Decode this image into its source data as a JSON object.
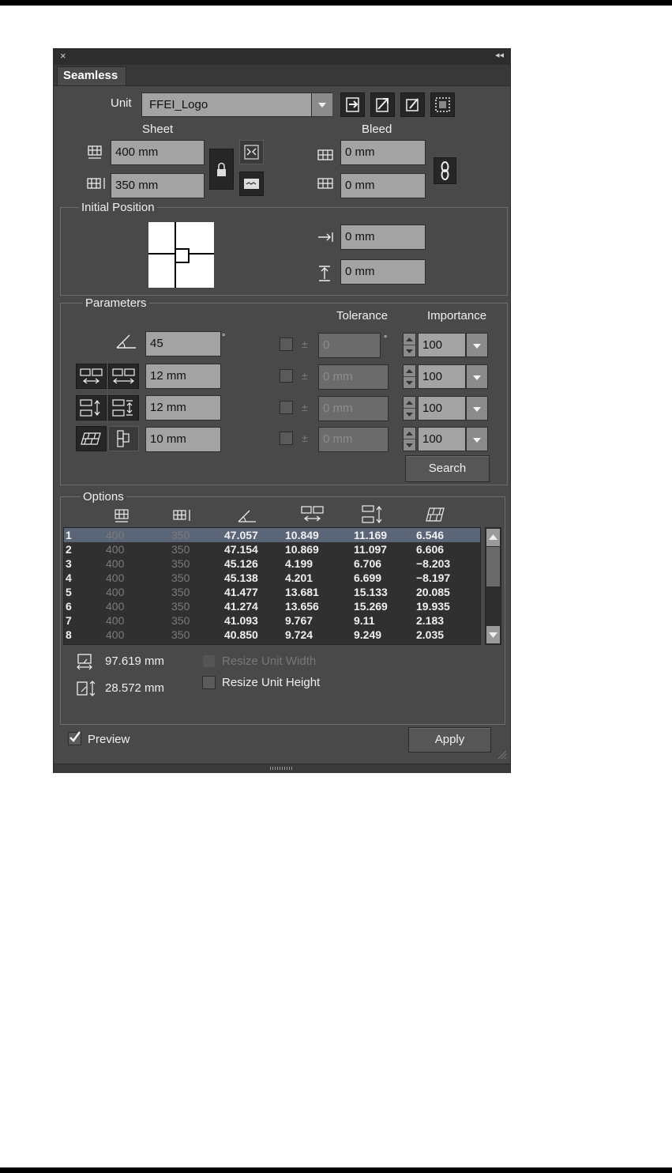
{
  "panel": {
    "tab": "Seamless",
    "close_glyph": "×",
    "collapse_glyph": "◂◂"
  },
  "unit": {
    "label": "Unit",
    "value": "FFEI_Logo"
  },
  "sheet": {
    "label": "Sheet",
    "width": "400 mm",
    "height": "350 mm"
  },
  "bleed": {
    "label": "Bleed",
    "horizontal": "0 mm",
    "vertical": "0 mm"
  },
  "initial_position": {
    "label": "Initial Position",
    "x_offset": "0 mm",
    "y_offset": "0 mm"
  },
  "parameters": {
    "label": "Parameters",
    "tolerance_header": "Tolerance",
    "importance_header": "Importance",
    "degree_symbol": "°",
    "plus_minus": "±",
    "rows": [
      {
        "value": "45",
        "tolerance": "0",
        "importance": "100"
      },
      {
        "value": "12 mm",
        "tolerance": "0 mm",
        "importance": "100"
      },
      {
        "value": "12 mm",
        "tolerance": "0 mm",
        "importance": "100"
      },
      {
        "value": "10 mm",
        "tolerance": "0 mm",
        "importance": "100"
      }
    ],
    "search_label": "Search"
  },
  "options": {
    "label": "Options",
    "rows": [
      [
        "1",
        "400",
        "350",
        "47.057",
        "10.849",
        "11.169",
        "6.546"
      ],
      [
        "2",
        "400",
        "350",
        "47.154",
        "10.869",
        "11.097",
        "6.606"
      ],
      [
        "3",
        "400",
        "350",
        "45.126",
        "4.199",
        "6.706",
        "−8.203"
      ],
      [
        "4",
        "400",
        "350",
        "45.138",
        "4.201",
        "6.699",
        "−8.197"
      ],
      [
        "5",
        "400",
        "350",
        "41.477",
        "13.681",
        "15.133",
        "20.085"
      ],
      [
        "6",
        "400",
        "350",
        "41.274",
        "13.656",
        "15.269",
        "19.935"
      ],
      [
        "7",
        "400",
        "350",
        "41.093",
        "9.767",
        "9.11",
        "2.183"
      ],
      [
        "8",
        "400",
        "350",
        "40.850",
        "9.724",
        "9.249",
        "2.035"
      ]
    ],
    "unit_width": "97.619 mm",
    "unit_height": "28.572 mm",
    "resize_width_label": "Resize Unit Width",
    "resize_height_label": "Resize Unit Height"
  },
  "footer": {
    "preview_label": "Preview",
    "preview_checked": true,
    "apply_label": "Apply"
  }
}
